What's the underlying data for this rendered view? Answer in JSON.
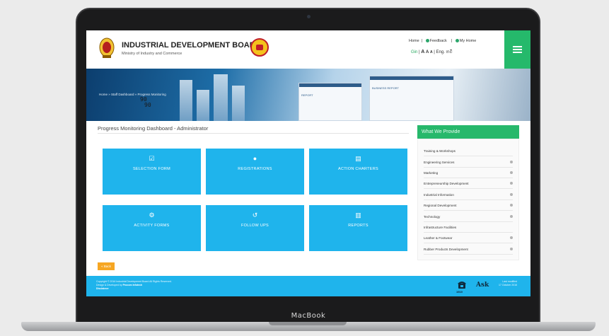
{
  "device": {
    "brand": "MacBook"
  },
  "header": {
    "title": "INDUSTRIAL DEVELOPMENT BOARD",
    "subtitle": "Ministry of Industry and Commerce",
    "links": [
      "Home",
      "Feedback",
      "My Home"
    ],
    "lang_sinhala": "Gin",
    "font_sizes": [
      "A",
      "A",
      "A"
    ],
    "lang_tamil": "Eng. තමි"
  },
  "banner": {
    "breadcrumb": "Home » Staff Dashboard » Progress Monitoring",
    "numbers": [
      "90",
      "90"
    ],
    "report_labels": [
      "REPORT",
      "BUSINESS REPORT"
    ]
  },
  "main": {
    "page_title": "Progress Monitoring Dashboard - Administrator",
    "tiles": [
      {
        "label": "SELECTION FORM",
        "icon": "checkbox-icon",
        "glyph": "☑"
      },
      {
        "label": "REGISTRATIONS",
        "icon": "circle-icon",
        "glyph": "●"
      },
      {
        "label": "ACTION CHARTERS",
        "icon": "document-icon",
        "glyph": "▤"
      },
      {
        "label": "ACTIVITY FORMS",
        "icon": "gears-icon",
        "glyph": "⚙"
      },
      {
        "label": "FOLLOW UPS",
        "icon": "history-icon",
        "glyph": "↺"
      },
      {
        "label": "REPORTS",
        "icon": "bar-chart-icon",
        "glyph": "▥"
      }
    ],
    "back_label": "« Back"
  },
  "sidebar": {
    "title": "What We Provide",
    "items": [
      {
        "label": "Training & Workshops",
        "arrow": false
      },
      {
        "label": "Engineering Services",
        "arrow": true
      },
      {
        "label": "Marketing",
        "arrow": true
      },
      {
        "label": "Entrepreneurship Development",
        "arrow": true
      },
      {
        "label": "Industrial Information",
        "arrow": true
      },
      {
        "label": "Regional Development",
        "arrow": true
      },
      {
        "label": "Technology",
        "arrow": true
      },
      {
        "label": "Infrastructure Facilities",
        "arrow": false
      },
      {
        "label": "Leather & Footwear",
        "arrow": true
      },
      {
        "label": "Rubber Products Development",
        "arrow": true
      }
    ]
  },
  "footer": {
    "copyright": "Copyright © 2016 Industrial Development Board All Rights Reserved.",
    "design": "Design & Developed by",
    "developer": "Procom Infotech",
    "disclaimer": "Disclaimer",
    "phone_label": "1919",
    "ask": "Ask",
    "updated_label": "Last modified",
    "updated_date": "17 October 2016"
  },
  "colors": {
    "accent": "#1fb4ec",
    "green": "#25b96b",
    "back": "#f6a623"
  }
}
